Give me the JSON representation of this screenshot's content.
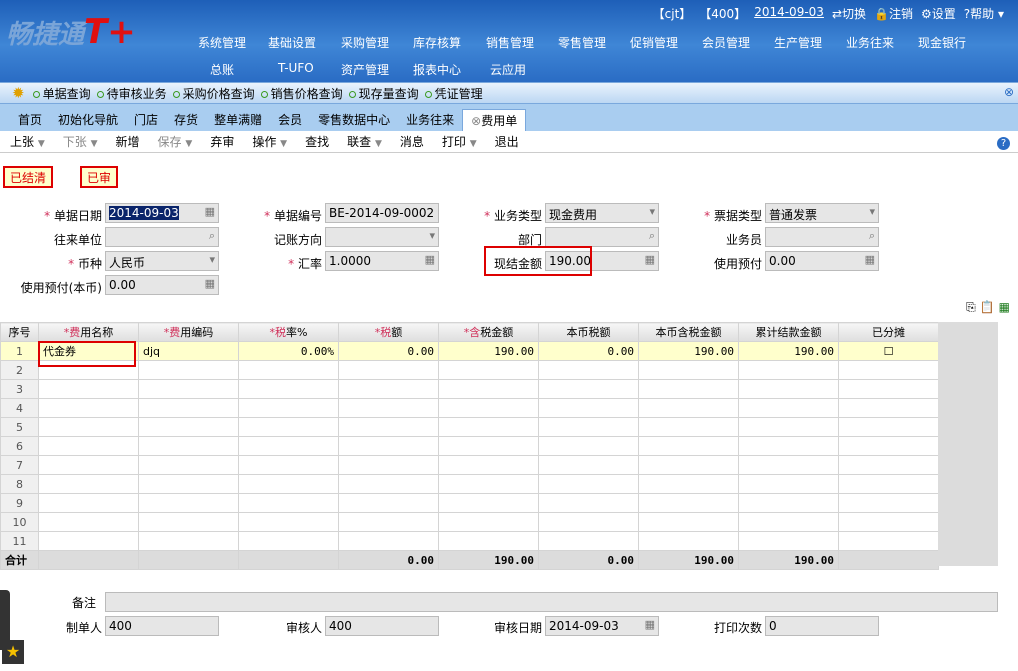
{
  "header": {
    "logo": "畅捷通",
    "logo_mark": "T+",
    "user": "【cjt】",
    "account": "【400】",
    "date": "2014-09-03",
    "switch": "切换",
    "logout": "注销",
    "settings": "设置",
    "help": "帮助",
    "menu_row1": [
      "系统管理",
      "基础设置",
      "采购管理",
      "库存核算",
      "销售管理",
      "零售管理",
      "促销管理",
      "会员管理",
      "生产管理",
      "业务往来",
      "现金银行"
    ],
    "menu_row2": [
      "总账",
      "T-UFO",
      "资产管理",
      "报表中心",
      "云应用"
    ]
  },
  "quick_links": [
    "单据查询",
    "待审核业务",
    "采购价格查询",
    "销售价格查询",
    "现存量查询",
    "凭证管理"
  ],
  "tabs": [
    "首页",
    "初始化导航",
    "门店",
    "存货",
    "整单满赠",
    "会员",
    "零售数据中心",
    "业务往来",
    "费用单"
  ],
  "toolbar": [
    "上张",
    "下张",
    "新增",
    "保存",
    "弃审",
    "操作",
    "查找",
    "联查",
    "消息",
    "打印",
    "退出"
  ],
  "status": {
    "closed": "已结清",
    "audited": "已审"
  },
  "form": {
    "date_label": "单据日期",
    "date": "2014-09-03",
    "code_label": "单据编号",
    "code": "BE-2014-09-0002",
    "biz_type_label": "业务类型",
    "biz_type": "现金费用",
    "invoice_type_label": "票据类型",
    "invoice_type": "普通发票",
    "partner_label": "往来单位",
    "direction_label": "记账方向",
    "dept_label": "部门",
    "staff_label": "业务员",
    "currency_label": "币种",
    "currency": "人民币",
    "rate_label": "汇率",
    "rate": "1.0000",
    "cash_label": "现结金额",
    "cash": "190.00",
    "prepay_label": "使用预付",
    "prepay": "0.00",
    "prepay_local_label": "使用预付(本币)",
    "prepay_local": "0.00"
  },
  "grid": {
    "headers": [
      "序号",
      "*费用名称",
      "*费用编码",
      "*税率%",
      "*税额",
      "*含税金额",
      "本币税额",
      "本币含税金额",
      "累计结款金额",
      "已分摊"
    ],
    "rows": [
      [
        "1",
        "代金券",
        "djq",
        "0.00%",
        "0.00",
        "190.00",
        "0.00",
        "190.00",
        "190.00",
        ""
      ]
    ],
    "empty_rows": [
      "2",
      "3",
      "4",
      "5",
      "6",
      "7",
      "8",
      "9",
      "10",
      "11"
    ],
    "total": [
      "合计",
      "",
      "",
      "",
      "0.00",
      "190.00",
      "0.00",
      "190.00",
      "190.00",
      ""
    ]
  },
  "footer": {
    "remark_label": "备注",
    "maker_label": "制单人",
    "maker": "400",
    "auditor_label": "审核人",
    "auditor": "400",
    "audit_date_label": "审核日期",
    "audit_date": "2014-09-03",
    "print_label": "打印次数",
    "print_count": "0"
  }
}
